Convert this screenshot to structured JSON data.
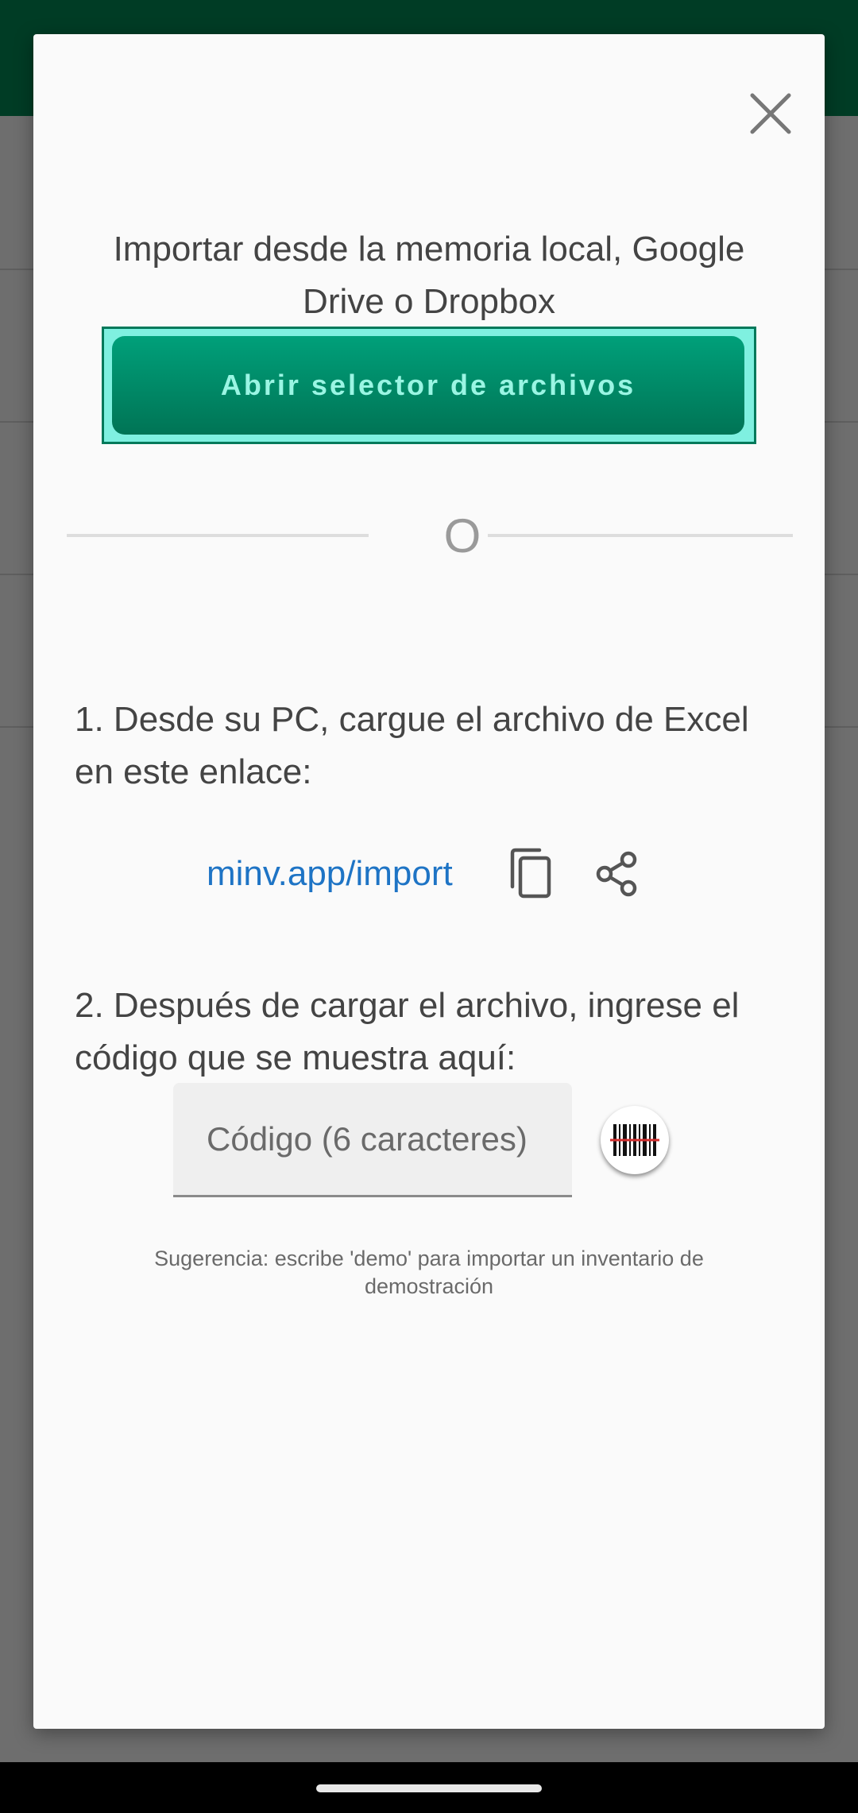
{
  "dialog": {
    "title": "Importar desde la memoria local, Google Drive o Dropbox",
    "file_picker_label": "Abrir selector de archivos",
    "divider_text": "O",
    "step1_text": "1. Desde su PC, cargue el archivo de Excel en este enlace:",
    "link_text": "minv.app/import",
    "step2_text": "2. Después de cargar el archivo, ingrese el código que se muestra aquí:",
    "code_placeholder": "Código (6 caracteres)",
    "code_value": "",
    "hint": "Sugerencia: escribe 'demo' para importar un inventario de demostración"
  },
  "icons": {
    "close": "close-icon",
    "copy": "copy-icon",
    "share": "share-icon",
    "barcode": "barcode-scanner-icon"
  },
  "colors": {
    "appbar": "#003c25",
    "accent_button": "#00875f",
    "link": "#1e74c5",
    "scan_line": "#d32f2f"
  }
}
